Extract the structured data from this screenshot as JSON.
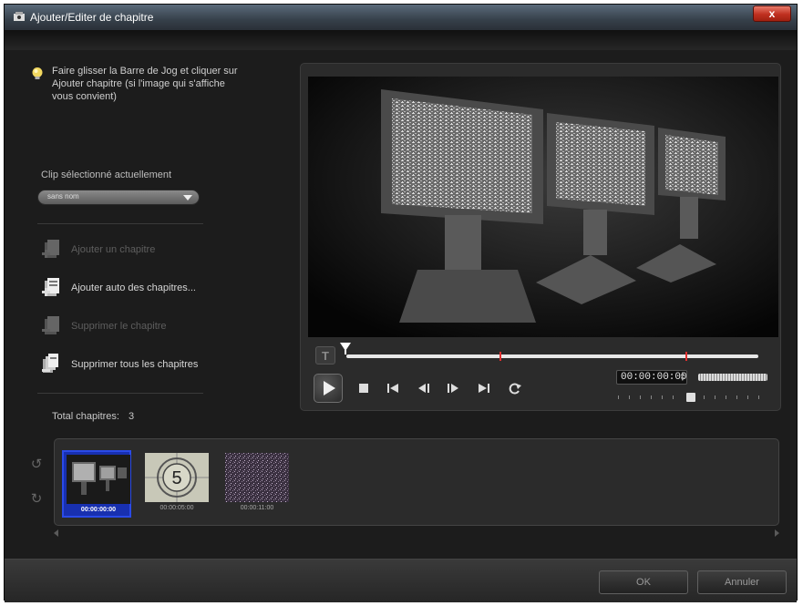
{
  "window": {
    "title": "Ajouter/Editer de chapitre",
    "close_glyph": "x"
  },
  "tip": {
    "icon": "lightbulb-icon",
    "text": "Faire glisser la Barre de Jog et cliquer sur Ajouter chapitre (si l'image qui s'affiche vous convient)"
  },
  "clip": {
    "label": "Clip sélectionné actuellement",
    "selected": "sans nom"
  },
  "actions": {
    "add_chapter": {
      "label": "Ajouter un chapitre",
      "icon": "add-chapter-icon"
    },
    "auto_add": {
      "label": "Ajouter auto des chapitres...",
      "icon": "auto-add-chapters-icon"
    },
    "delete_chapter": {
      "label": "Supprimer le chapitre",
      "icon": "delete-chapter-icon"
    },
    "delete_all": {
      "label": "Supprimer tous les chapitres",
      "icon": "delete-all-chapters-icon"
    }
  },
  "total": {
    "label": "Total chapitres:",
    "value": "3"
  },
  "player": {
    "timecode": "00:00:00:00",
    "title_button": "T"
  },
  "thumbnails": [
    {
      "timecode": "00:00:00:00",
      "selected": true
    },
    {
      "timecode": "00:00:05:00",
      "selected": false,
      "countdown": "5"
    },
    {
      "timecode": "00:00:11:00",
      "selected": false
    }
  ],
  "buttons": {
    "ok": "OK",
    "cancel": "Annuler"
  },
  "colors": {
    "selection": "#1830b0",
    "chapter_marker": "#e03030",
    "close": "#c03020"
  }
}
